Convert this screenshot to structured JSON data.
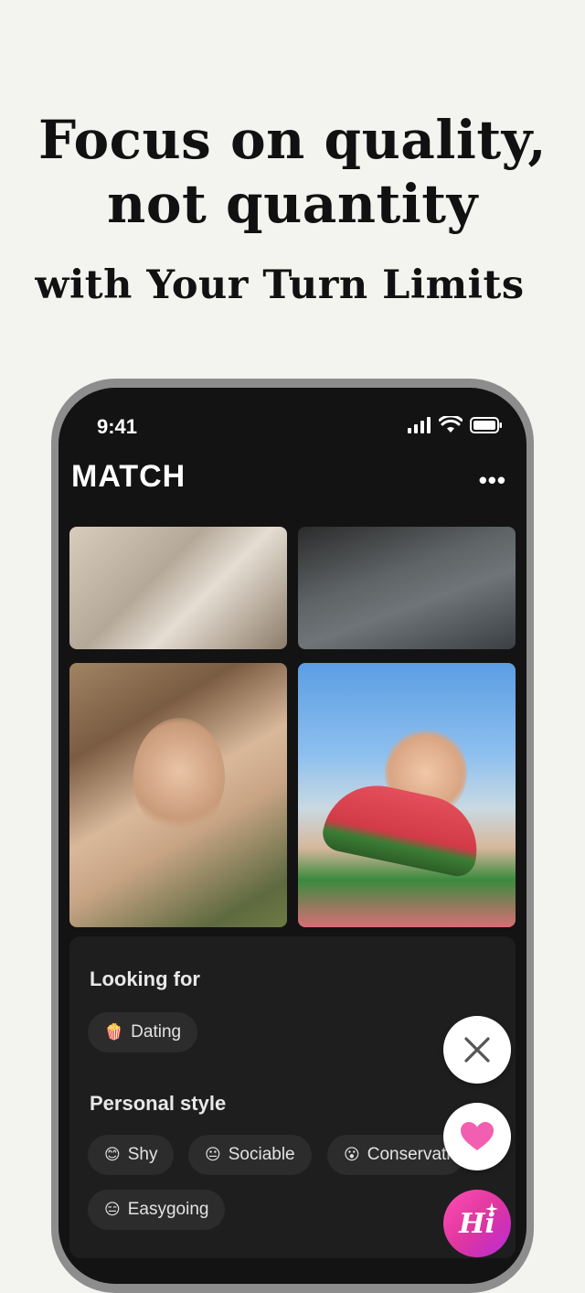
{
  "headline": {
    "line1": "Focus on quality,",
    "line2": "not quantity",
    "subline": "with Your Turn Limits"
  },
  "status_bar": {
    "time": "9:41"
  },
  "app": {
    "title": "MATCH",
    "more_label": "•••"
  },
  "profile": {
    "looking_for_title": "Looking for",
    "looking_for": {
      "emoji": "🍿",
      "label": "Dating"
    },
    "personal_style_title": "Personal style",
    "styles": [
      {
        "emoji": "😊",
        "label": "Shy"
      },
      {
        "emoji": "😐",
        "label": "Sociable"
      },
      {
        "emoji": "😮",
        "label": "Conservative"
      },
      {
        "emoji": "😑",
        "label": "Easygoing"
      }
    ]
  },
  "actions": {
    "hi_label": "Hi"
  },
  "colors": {
    "accent_heart": "#f25fb0",
    "hi_gradient_start": "#ff4fb5",
    "hi_gradient_end": "#b62bd6"
  }
}
